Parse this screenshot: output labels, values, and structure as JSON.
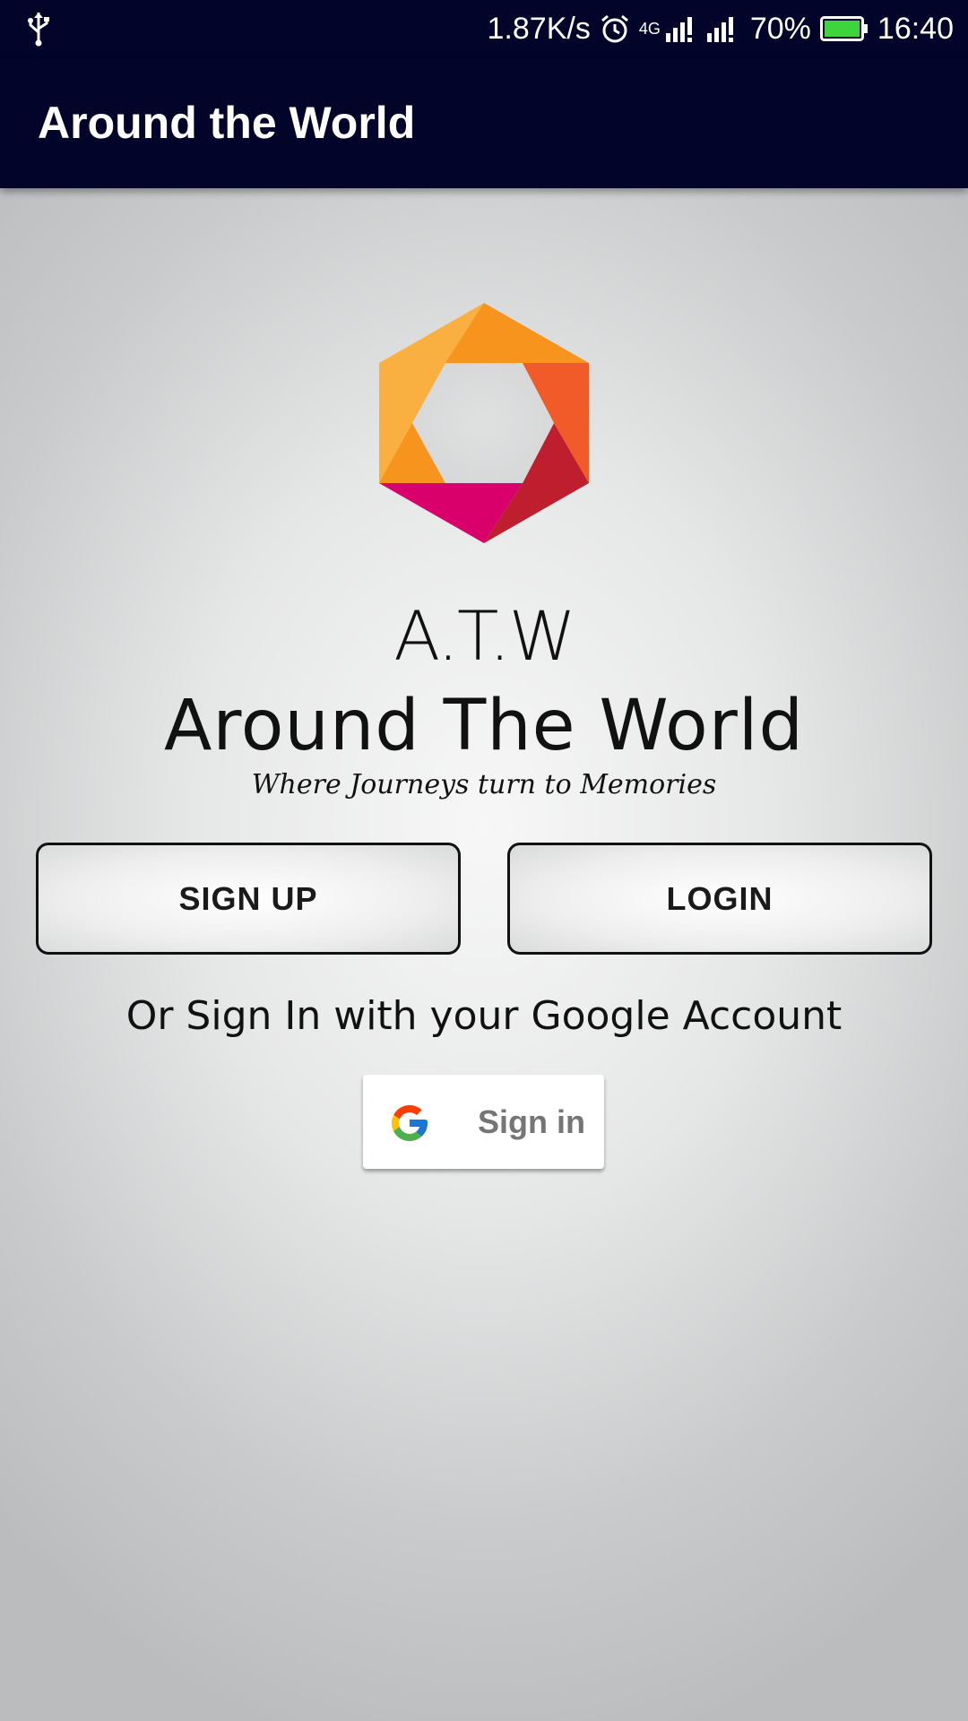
{
  "status_bar": {
    "net_speed": "1.87K/s",
    "network_type": "4G",
    "battery": "70%",
    "time": "16:40",
    "icons": [
      "usb-icon",
      "alarm-icon",
      "signal-icon",
      "battery-icon"
    ]
  },
  "app_bar": {
    "title": "Around the World"
  },
  "hero": {
    "abbreviation": "A.T.W",
    "name": "Around The World",
    "tagline": "Where Journeys turn to Memories"
  },
  "actions": {
    "signup_label": "SIGN UP",
    "login_label": "LOGIN"
  },
  "google": {
    "prompt": "Or Sign In with your Google Account",
    "button_label": "Sign in"
  },
  "colors": {
    "app_bar": "#02042a",
    "logo": [
      "#f9b041",
      "#f7941e",
      "#f15a29",
      "#be1e2d",
      "#d9006c"
    ]
  }
}
